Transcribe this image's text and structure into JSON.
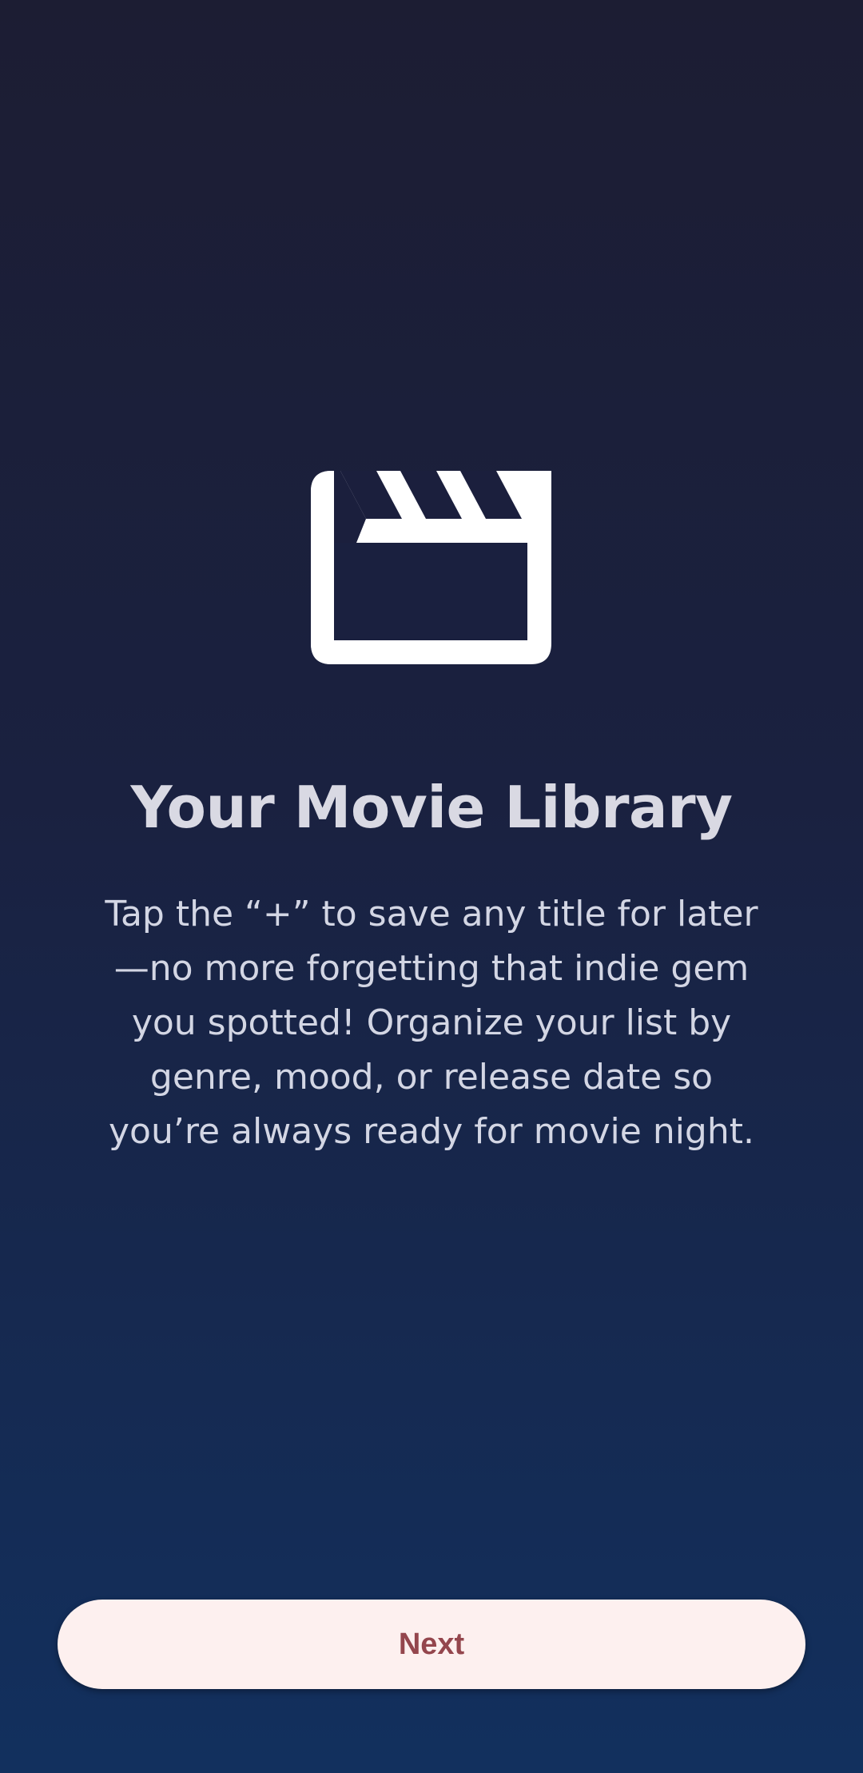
{
  "onboarding": {
    "icon": "movie-clapperboard-icon",
    "title": "Your Movie Library",
    "description": "Tap the “+” to save any title for later—no more forgetting that indie gem you spotted! Organize your list by genre, mood, or release date so you’re always ready for movie night.",
    "next_label": "Next"
  },
  "colors": {
    "background_top": "#1c1d33",
    "background_bottom": "#12305e",
    "icon": "#ffffff",
    "title": "#d9d9e3",
    "body_text": "#d3d6e4",
    "button_background": "#fdf0ef",
    "button_text": "#94464d"
  }
}
